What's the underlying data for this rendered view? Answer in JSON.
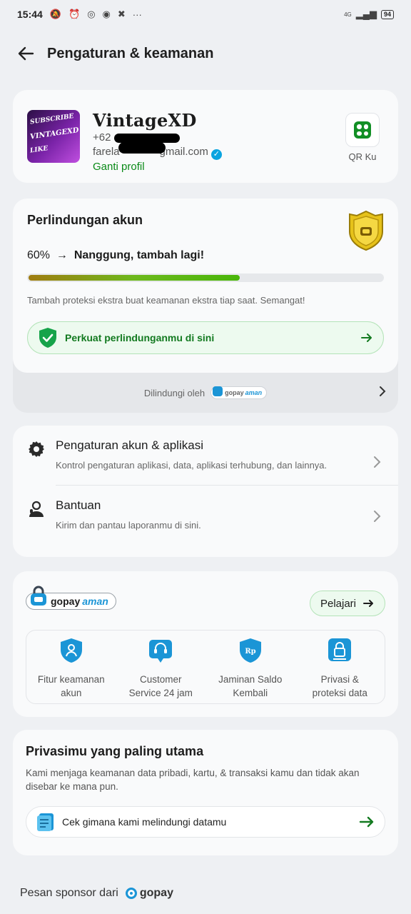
{
  "status_bar": {
    "time": "15:44",
    "battery": "94",
    "network": "4G"
  },
  "header": {
    "title": "Pengaturan & keamanan"
  },
  "profile": {
    "name": "VintageXD",
    "phone_visible": "+62",
    "email_prefix": "farela",
    "email_suffix": "gmail.com",
    "edit_label": "Ganti profil",
    "qr_label": "QR Ku",
    "avatar_text": [
      "SUBSCRIBE",
      "VINTAGEXD",
      "LIKE"
    ]
  },
  "protection": {
    "title": "Perlindungan akun",
    "percent_label": "60%",
    "status_text": "Nanggung, tambah lagi!",
    "progress": 0.6,
    "description": "Tambah proteksi ekstra buat keamanan ekstra tiap saat. Semangat!",
    "cta_label": "Perkuat perlindunganmu di sini",
    "footer_label": "Dilindungi oleh",
    "footer_brand": "gopay",
    "footer_brand_accent": "aman"
  },
  "settings": {
    "items": [
      {
        "title": "Pengaturan akun & aplikasi",
        "subtitle": "Kontrol pengaturan aplikasi, data, aplikasi terhubung, dan lainnya.",
        "icon": "gear-icon"
      },
      {
        "title": "Bantuan",
        "subtitle": "Kirim dan pantau laporanmu di sini.",
        "icon": "support-agent-icon"
      }
    ]
  },
  "gopay_aman": {
    "brand": "gopay",
    "brand_accent": "aman",
    "learn_label": "Pelajari",
    "features": [
      {
        "line1": "Fitur keamanan",
        "line2": "akun",
        "icon": "user-shield-icon"
      },
      {
        "line1": "Customer",
        "line2": "Service 24 jam",
        "icon": "headset-icon"
      },
      {
        "line1": "Jaminan Saldo",
        "line2": "Kembali",
        "icon": "rupiah-shield-icon"
      },
      {
        "line1": "Privasi &",
        "line2": "proteksi data",
        "icon": "lock-icon"
      }
    ]
  },
  "privacy": {
    "title": "Privasimu yang paling utama",
    "description": "Kami menjaga keamanan data pribadi, kartu, & transaksi kamu dan tidak akan disebar ke mana pun.",
    "cta_label": "Cek gimana kami melindungi datamu"
  },
  "sponsor": {
    "label": "Pesan sponsor dari",
    "brand": "gopay"
  },
  "colors": {
    "accent_green": "#0a8a18",
    "gopay_blue": "#1b95d6",
    "background": "#eef0f3"
  }
}
